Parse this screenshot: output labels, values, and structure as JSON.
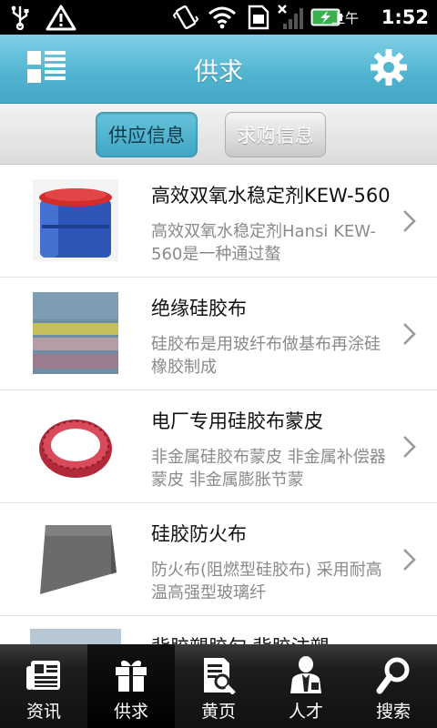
{
  "statusbar": {
    "ampm": "上午",
    "time": "1:52"
  },
  "header": {
    "title": "供求",
    "menu_icon": "list-icon",
    "settings_icon": "gear-icon"
  },
  "tabs": [
    {
      "label": "供应信息",
      "active": true
    },
    {
      "label": "求购信息",
      "active": false
    }
  ],
  "list": {
    "items": [
      {
        "title": "高效双氧水稳定剂KEW-560",
        "desc": "高效双氧水稳定剂Hansi KEW-560是一种通过螯",
        "thumb": "blue-drum"
      },
      {
        "title": "绝缘硅胶布",
        "desc": "硅胶布是用玻纤布做基布再涂硅橡胶制成",
        "thumb": "silicone-cloth"
      },
      {
        "title": "电厂专用硅胶布蒙皮",
        "desc": "非金属硅胶布蒙皮 非金属补偿器蒙皮 非金属膨胀节蒙",
        "thumb": "red-ring"
      },
      {
        "title": "硅胶防火布",
        "desc": "防火布(阻燃型硅胶布) 采用耐高温高强型玻璃纤",
        "thumb": "gray-roll"
      },
      {
        "title": "背胶塑胶勾 背胶注塑",
        "desc": "",
        "thumb": "blue-panel"
      }
    ]
  },
  "bottomnav": [
    {
      "label": "资讯",
      "icon": "newspaper-icon",
      "active": false
    },
    {
      "label": "供求",
      "icon": "gift-icon",
      "active": true
    },
    {
      "label": "黄页",
      "icon": "document-search-icon",
      "active": false
    },
    {
      "label": "人才",
      "icon": "person-icon",
      "active": false
    },
    {
      "label": "搜索",
      "icon": "search-icon",
      "active": false
    }
  ]
}
